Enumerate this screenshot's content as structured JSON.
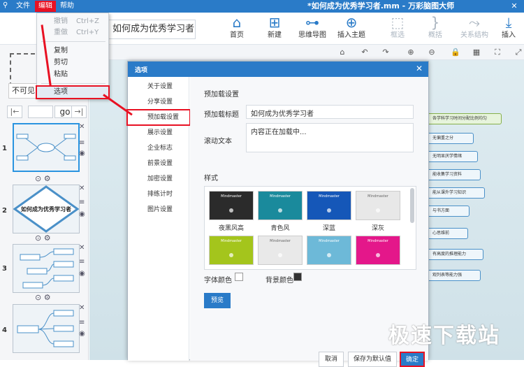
{
  "titlebar": {
    "menus": [
      "文件",
      "编辑",
      "帮助"
    ],
    "title": "*如何成为优秀学习者.mm - 万彩脑图大师"
  },
  "ribbon": {
    "topic_value": "如何成为优秀学习者",
    "buttons": [
      "首页",
      "新建",
      "思维导图",
      "插入主题",
      "框选",
      "概括",
      "关系结构",
      "插入"
    ]
  },
  "edit_menu": {
    "undo": "撤销",
    "undo_shortcut": "Ctrl+Z",
    "redo": "重做",
    "redo_shortcut": "Ctrl+Y",
    "copy": "复制",
    "cut": "剪切",
    "paste": "粘贴",
    "options": "选项"
  },
  "left_panel": {
    "dropdown_value": "不可见",
    "go_label": "go",
    "slides": [
      {
        "num": "1"
      },
      {
        "num": "2",
        "text": "如何成为优秀学习者"
      },
      {
        "num": "3"
      },
      {
        "num": "4"
      }
    ]
  },
  "canvas": {
    "nodes": [
      "各学科学习时间分配比例均匀",
      "无偏重之分",
      "无明显厌学情绪",
      "能收集学习资料",
      "能从课外学习知识",
      "与书方面",
      "心思维前",
      "有高度的推理能力",
      "观列表等能力强"
    ]
  },
  "dialog": {
    "title": "选项",
    "nav": [
      "关于设置",
      "分享设置",
      "预加载设置",
      "展示设置",
      "企业标志",
      "前景设置",
      "加密设置",
      "排练计时",
      "图片设置"
    ],
    "section_title": "预加载设置",
    "preload_title_label": "预加载标题",
    "preload_title_value": "如何成为优秀学习者",
    "scroll_text_label": "滚动文本",
    "scroll_text_value": "内容正在加载中...",
    "style_label": "样式",
    "swatch_caption": "Mindmaster",
    "styles": [
      {
        "name": "夜黑风高",
        "color": "#2b2b2b"
      },
      {
        "name": "青色风",
        "color": "#1a8a9c"
      },
      {
        "name": "深蓝",
        "color": "#1557b8"
      },
      {
        "name": "深灰",
        "color": "#e8e8e8"
      },
      {
        "name": "",
        "color": "#a4c51c"
      },
      {
        "name": "",
        "color": "#e9e9e9"
      },
      {
        "name": "",
        "color": "#6db9d8"
      },
      {
        "name": "",
        "color": "#e4178a"
      }
    ],
    "font_color_label": "字体颜色",
    "bg_color_label": "背景颜色",
    "preview_button": "预览",
    "cancel_button": "取消",
    "save_default_button": "保存为默认值",
    "ok_button": "确定"
  },
  "watermark": "极速下载站"
}
